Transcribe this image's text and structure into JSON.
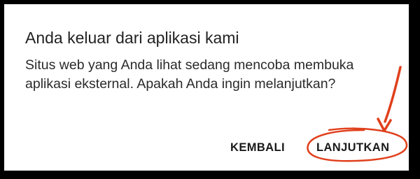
{
  "dialog": {
    "title": "Anda keluar dari aplikasi kami",
    "message": "Situs web yang Anda lihat sedang mencoba membuka aplikasi eksternal. Apakah Anda ingin melanjutkan?",
    "buttons": {
      "back_label": "KEMBALI",
      "continue_label": "LANJUTKAN"
    }
  },
  "annotation": {
    "color": "#e0401c",
    "marks": [
      "arrow-icon",
      "circle-highlight"
    ]
  }
}
